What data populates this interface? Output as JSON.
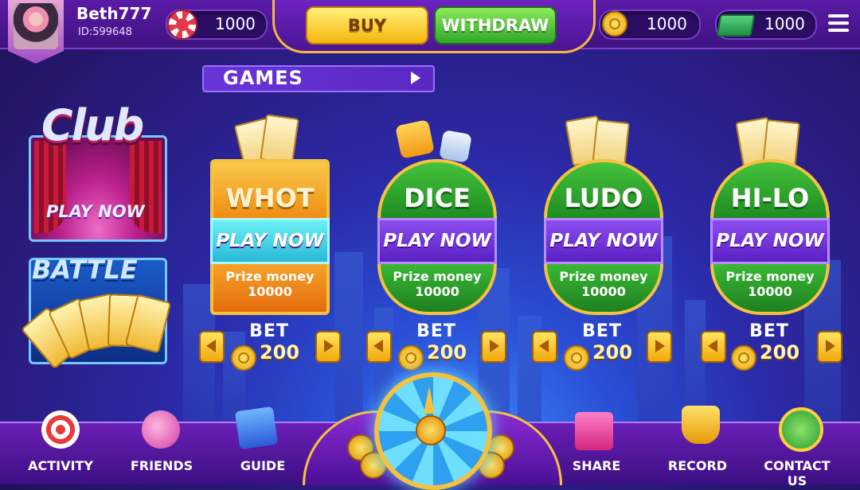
{
  "user": {
    "name": "Beth777",
    "id": "ID:599648"
  },
  "balances": {
    "chips": "1000",
    "coins": "1000",
    "cash": "1000"
  },
  "actions": {
    "buy": "BUY",
    "withdraw": "WITHDRAW"
  },
  "section": {
    "games": "GAMES"
  },
  "side": {
    "club_title": "Club",
    "club_play": "PLAY NOW",
    "battle_title": "BATTLE"
  },
  "games": [
    {
      "name": "WHOT",
      "play": "PLAY NOW",
      "prize_label": "Prize money",
      "prize": "10000",
      "bet_label": "BET",
      "bet": "200"
    },
    {
      "name": "DICE",
      "play": "PLAY NOW",
      "prize_label": "Prize money",
      "prize": "10000",
      "bet_label": "BET",
      "bet": "200"
    },
    {
      "name": "LUDO",
      "play": "PLAY NOW",
      "prize_label": "Prize money",
      "prize": "10000",
      "bet_label": "BET",
      "bet": "200"
    },
    {
      "name": "HI-LO",
      "play": "PLAY NOW",
      "prize_label": "Prize money",
      "prize": "10000",
      "bet_label": "BET",
      "bet": "200"
    }
  ],
  "nav": {
    "activity": "ACTIVITY",
    "friends": "FRIENDS",
    "guide": "GUIDE",
    "share": "SHARE",
    "record": "RECORD",
    "contact": "CONTACT US"
  },
  "colors": {
    "accent_gold": "#f4c23f",
    "whot": "#f0a020",
    "green": "#2e9e2a",
    "purple_band": "#6a2bd0",
    "teal_band": "#37d6e0"
  }
}
